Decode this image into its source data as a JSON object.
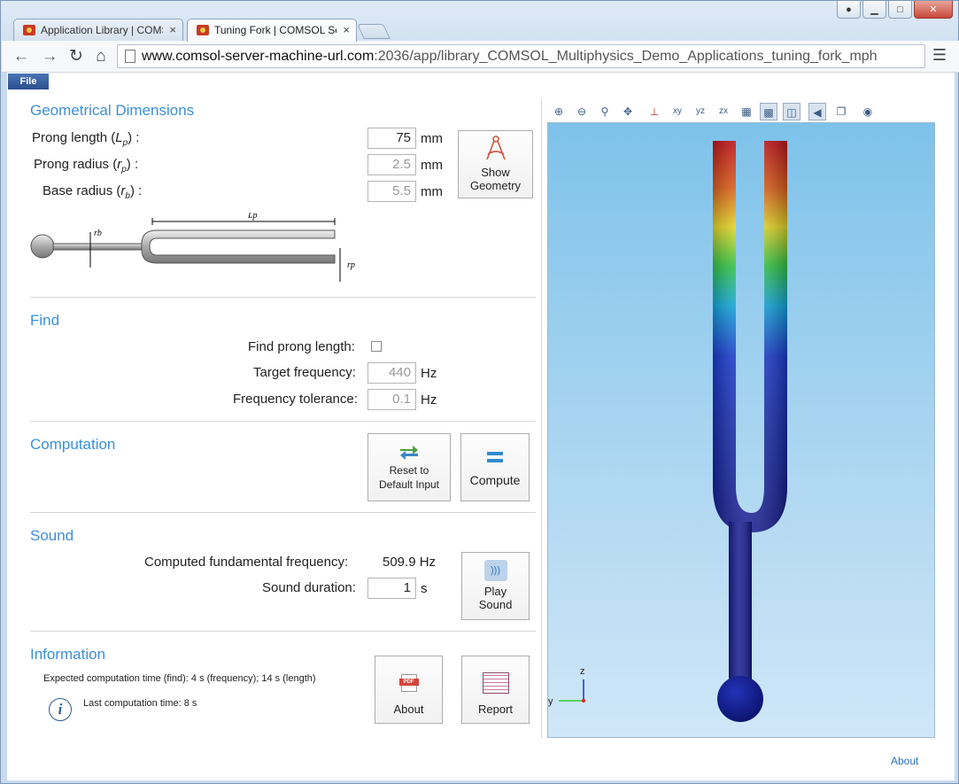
{
  "browser": {
    "tabs": [
      {
        "label": "Application Library | COMSOL Server",
        "active": false
      },
      {
        "label": "Tuning Fork | COMSOL Server",
        "active": true
      }
    ],
    "url_host": "www.comsol-server-machine-url.com",
    "url_path": ":2036/app/library_COMSOL_Multiphysics_Demo_Applications_tuning_fork_mph",
    "window_buttons": {
      "minimize": "▁",
      "maximize": "□",
      "close": "✕"
    }
  },
  "menu": {
    "file_label": "File"
  },
  "geometry": {
    "title": "Geometrical Dimensions",
    "prong_length_label": "Prong length (",
    "prong_length_sym": "L",
    "prong_length_sub": "p",
    "prong_length_value": "75",
    "prong_radius_label": "Prong radius (",
    "prong_radius_sym": "r",
    "prong_radius_sub": "p",
    "prong_radius_value": "2.5",
    "base_radius_label": "Base radius (",
    "base_radius_sym": "r",
    "base_radius_sub": "b",
    "base_radius_value": "5.5",
    "unit": "mm",
    "show_button_line1": "Show",
    "show_button_line2": "Geometry",
    "sketch_label_lp": "Lp",
    "sketch_label_rb": "rb",
    "sketch_label_rp": "rp"
  },
  "find": {
    "title": "Find",
    "find_prong_label": "Find prong length:",
    "find_prong_checked": false,
    "target_freq_label": "Target frequency:",
    "target_freq_value": "440",
    "tolerance_label": "Frequency tolerance:",
    "tolerance_value": "0.1",
    "unit": "Hz"
  },
  "computation": {
    "title": "Computation",
    "reset_line1": "Reset to",
    "reset_line2": "Default Input",
    "compute_label": "Compute"
  },
  "sound": {
    "title": "Sound",
    "computed_freq_label": "Computed fundamental frequency:",
    "computed_freq_value": "509.9 Hz",
    "duration_label": "Sound duration:",
    "duration_value": "1",
    "duration_unit": "s",
    "play_line1": "Play",
    "play_line2": "Sound"
  },
  "information": {
    "title": "Information",
    "expected_time": "Expected computation time (find):  4 s (frequency); 14 s (length)",
    "last_time": "Last computation time: 8 s",
    "about_label": "About",
    "report_label": "Report"
  },
  "graphics": {
    "axis_z": "z",
    "axis_y": "y",
    "colors": {
      "top": "#c8141a",
      "yellow": "#f2e22a",
      "green": "#35d04a",
      "cyan": "#16b0e8",
      "blue": "#1d3fd8",
      "dark": "#141a8c"
    }
  },
  "footer": {
    "about_link": "About"
  }
}
